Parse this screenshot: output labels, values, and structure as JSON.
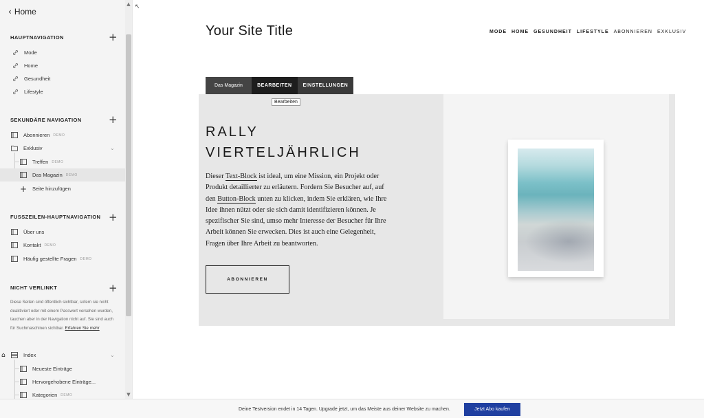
{
  "sidebar": {
    "back_label": "Home",
    "sections": {
      "primary_title": "HAUPTNAVIGATION",
      "secondary_title": "SEKUNDÄRE NAVIGATION",
      "footer_title": "FUSSZEILEN-HAUPTNAVIGATION",
      "unlinked_title": "NICHT VERLINKT"
    },
    "primary_items": [
      "Mode",
      "Home",
      "Gesundheit",
      "Lifestyle"
    ],
    "secondary": {
      "abonnieren": "Abonnieren",
      "exklusiv": "Exklusiv",
      "treffen": "Treffen",
      "magazin": "Das Magazin",
      "add_page": "Seite hinzufügen"
    },
    "footer_items": {
      "ueber_uns": "Über uns",
      "kontakt": "Kontakt",
      "faq": "Häufig gestellte Fragen"
    },
    "demo_badge": "DEMO",
    "unlinked_note": "Diese Seiten sind öffentlich sichtbar, sofern sie nicht deaktiviert oder mit einem Passwort versehen wurden, tauchen aber in der Navigation nicht auf. Sie sind auch für Suchmaschinen sichtbar.",
    "unlinked_link": "Erfahren Sie mehr",
    "index": {
      "label": "Index",
      "children": [
        "Neueste Einträge",
        "Hervorgehobene Einträge...",
        "Kategorien"
      ]
    }
  },
  "site": {
    "title": "Your Site Title",
    "nav": [
      "MODE",
      "HOME",
      "GESUNDHEIT",
      "LIFESTYLE",
      "ABONNIEREN",
      "EXKLUSIV"
    ]
  },
  "edit_bar": {
    "page_label": "Das Magazin",
    "edit_label": "BEARBEITEN",
    "settings_label": "EINSTELLUNGEN",
    "tooltip": "Bearbeiten"
  },
  "hero": {
    "title_line1": "RALLY",
    "title_line2": "VIERTELJÄHRLICH",
    "body_part1": "Dieser ",
    "body_link1": "Text-Block",
    "body_part2": " ist ideal, um eine Mission, ein Projekt oder Produkt detaillierter zu erläutern. Fordern Sie Besucher auf, auf den ",
    "body_link2": "Button-Block",
    "body_part3": " unten zu klicken, indem Sie erklären, wie Ihre Idee ihnen nützt oder sie sich damit identifizieren können. Je spezifischer Sie sind, umso mehr Interesse der Besucher für Ihre Arbeit können Sie erwecken. Dies ist auch eine Gelegenheit, Fragen über Ihre Arbeit zu beantworten.",
    "cta": "ABONNIEREN"
  },
  "banner": {
    "text": "Deine Testversion endet in 14 Tagen. Upgrade jetzt, um das Meiste aus deiner Website zu machen.",
    "button": "Jetzt Abo kaufen"
  }
}
